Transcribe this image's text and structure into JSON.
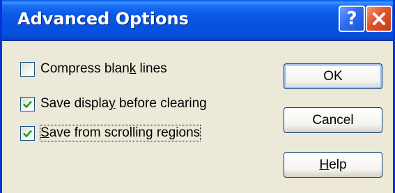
{
  "window": {
    "title": "Advanced Options",
    "help_glyph": "?"
  },
  "icons": {
    "help": "question-mark-icon",
    "close": "close-x-icon",
    "check": "checkmark-icon"
  },
  "colors": {
    "titlebar": "#0553e0",
    "close_button": "#e0532a",
    "check_green": "#21a121",
    "dialog_bg": "#ece9d8"
  },
  "options": [
    {
      "label_pre": "Compress blan",
      "label_key": "k",
      "label_post": " lines",
      "checked": false
    },
    {
      "label_pre": "Save display",
      "label_key": "y",
      "label_post": " before clearing",
      "label_mid": "Save displa",
      "checked": true
    },
    {
      "label_pre": "",
      "label_key": "S",
      "label_post": "ave from scrolling regions",
      "checked": true
    }
  ],
  "buttons": {
    "ok": "OK",
    "cancel": "Cancel",
    "help_key": "H",
    "help_rest": "elp"
  }
}
